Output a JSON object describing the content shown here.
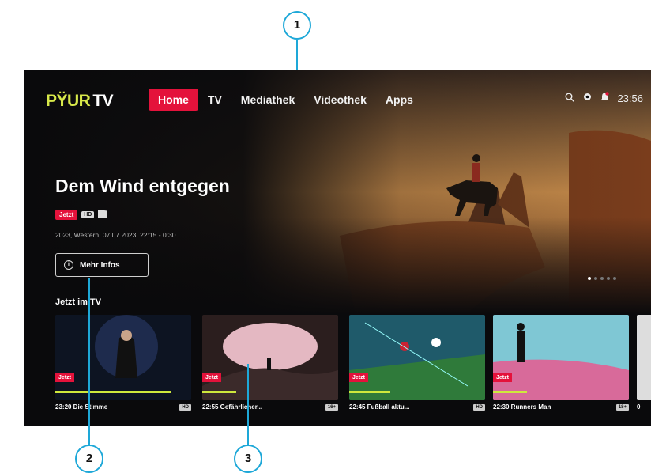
{
  "callouts": [
    "1",
    "2",
    "3"
  ],
  "header": {
    "logo_p": "PŸUR",
    "logo_tv": "TV",
    "nav": [
      {
        "label": "Home",
        "active": true
      },
      {
        "label": "TV",
        "active": false
      },
      {
        "label": "Mediathek",
        "active": false
      },
      {
        "label": "Videothek",
        "active": false
      },
      {
        "label": "Apps",
        "active": false
      }
    ],
    "clock": "23:56",
    "icons": [
      "search-icon",
      "gear-icon",
      "bell-icon"
    ]
  },
  "hero": {
    "title": "Dem Wind entgegen",
    "badge_now": "Jetzt",
    "badge_hd": "HD",
    "meta": "2023, Western, 07.07.2023, 22:15 - 0:30",
    "more_button": "Mehr Infos",
    "page_dots": 5,
    "current_page": 1
  },
  "row": {
    "title": "Jetzt im TV",
    "tiles": [
      {
        "time_title": "23:20 Die Stimme",
        "flag": "HD",
        "live": "Jetzt",
        "progress": 0.85
      },
      {
        "time_title": "22:55 Gefährlicher...",
        "flag": "16+",
        "live": "Jetzt",
        "progress": 0.25
      },
      {
        "time_title": "22:45 Fußball aktu...",
        "flag": "HD",
        "live": "Jetzt",
        "progress": 0.3
      },
      {
        "time_title": "22:30 Runners Man",
        "flag": "18+",
        "live": "Jetzt",
        "progress": 0.25
      },
      {
        "time_title": "0",
        "flag": "",
        "live": "",
        "progress": 0
      }
    ]
  },
  "colors": {
    "accent": "#e4123b",
    "progress": "#cfe83c",
    "callout": "#1ea8d8",
    "logo_p": "#d7e84a"
  }
}
